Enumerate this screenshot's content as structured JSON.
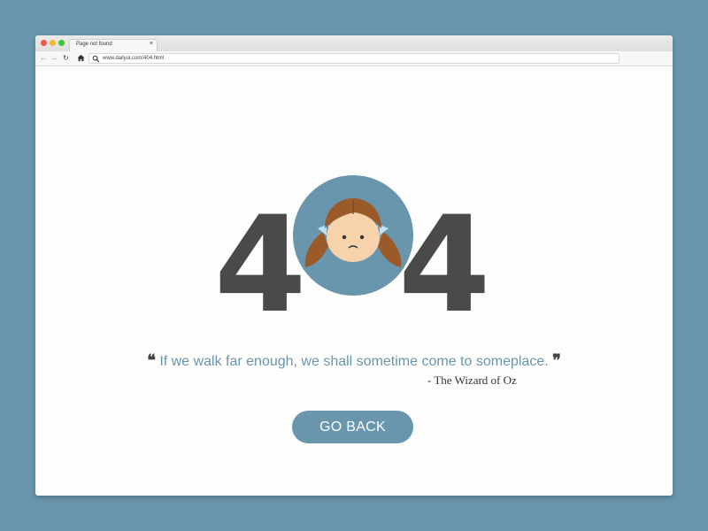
{
  "browser": {
    "tab": {
      "title": "Page not found",
      "close_label": "×"
    },
    "nav": {
      "back": "←",
      "forward": "→",
      "reload": "↻"
    },
    "url": "www.dailyui.com/404.html"
  },
  "page": {
    "digit_left": "4",
    "digit_right": "4",
    "quote_open": "❝",
    "quote_text": "If we walk far enough, we shall sometime come to someplace.",
    "quote_close": "❞",
    "attribution": "- The Wizard of Oz",
    "button_label": "GO BACK"
  },
  "colors": {
    "background": "#6a96ad",
    "accent": "#6a96ad",
    "digits": "#4a4a48",
    "page": "#fdfdfb"
  },
  "icons": [
    "back-arrow-icon",
    "forward-arrow-icon",
    "reload-icon",
    "home-icon",
    "search-icon",
    "tab-close-icon"
  ]
}
